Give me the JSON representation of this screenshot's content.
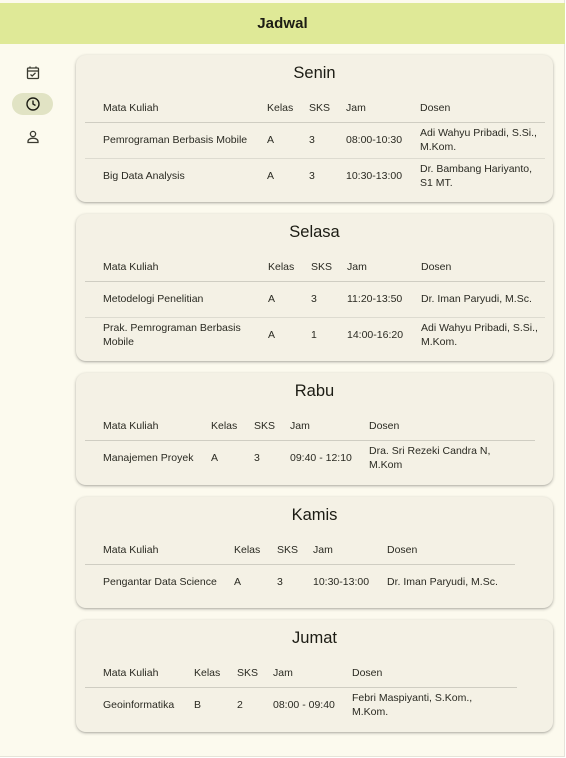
{
  "app": {
    "title": "Jadwal"
  },
  "nav": {
    "items": [
      {
        "icon": "calendar-check-icon",
        "active": false
      },
      {
        "icon": "clock-icon",
        "active": true
      },
      {
        "icon": "person-icon",
        "active": false
      }
    ]
  },
  "columns": {
    "course": "Mata Kuliah",
    "class": "Kelas",
    "sks": "SKS",
    "time": "Jam",
    "lecturer": "Dosen"
  },
  "days": [
    {
      "name": "Senin",
      "rows": [
        {
          "course": "Pemrograman Berbasis Mobile",
          "class": "A",
          "sks": "3",
          "time": "08:00-10:30",
          "lecturer": "Adi Wahyu Pribadi, S.Si., M.Kom."
        },
        {
          "course": "Big Data Analysis",
          "class": "A",
          "sks": "3",
          "time": "10:30-13:00",
          "lecturer": "Dr. Bambang Hariyanto, S1 MT."
        }
      ]
    },
    {
      "name": "Selasa",
      "rows": [
        {
          "course": "Metodelogi Penelitian",
          "class": "A",
          "sks": "3",
          "time": "11:20-13:50",
          "lecturer": "Dr. Iman Paryudi, M.Sc."
        },
        {
          "course": "Prak. Pemrograman Berbasis Mobile",
          "class": "A",
          "sks": "1",
          "time": "14:00-16:20",
          "lecturer": "Adi Wahyu Pribadi, S.Si., M.Kom."
        }
      ]
    },
    {
      "name": "Rabu",
      "rows": [
        {
          "course": "Manajemen Proyek",
          "class": "A",
          "sks": "3",
          "time": "09:40 - 12:10",
          "lecturer": "Dra. Sri Rezeki Candra N, M.Kom"
        }
      ]
    },
    {
      "name": "Kamis",
      "rows": [
        {
          "course": "Pengantar Data Science",
          "class": "A",
          "sks": "3",
          "time": "10:30-13:00",
          "lecturer": "Dr. Iman Paryudi, M.Sc."
        }
      ]
    },
    {
      "name": "Jumat",
      "rows": [
        {
          "course": "Geoinformatika",
          "class": "B",
          "sks": "2",
          "time": "08:00 - 09:40",
          "lecturer": "Febri Maspiyanti, S.Kom., M.Kom."
        }
      ]
    }
  ]
}
